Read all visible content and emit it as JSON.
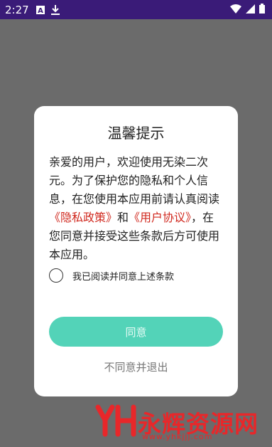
{
  "statusbar": {
    "time": "2:27",
    "icons": [
      "font-a-icon",
      "download-icon",
      "wifi-icon",
      "signal-icon",
      "battery-icon"
    ]
  },
  "dialog": {
    "title": "温馨提示",
    "text_prefix": "亲爱的用户，欢迎使用无染二次元。为了保护您的隐私和个人信息，在您使用本应用前请认真阅读",
    "privacy_link": "《隐私政策》",
    "conjunction": "和",
    "user_agreement_link": "《用户协议》",
    "text_suffix": "，在您同意并接受这些条款后方可使用本应用。",
    "checkbox_label": "我已阅读并同意上述条款",
    "agree_button": "同意",
    "disagree_button": "不同意并退出"
  },
  "watermark": {
    "text": "永辉资源网",
    "url": "www.yhkjjj.com"
  },
  "colors": {
    "status_bar": "#3a1b78",
    "overlay": "#6b6b6b",
    "accent": "#53d3b8",
    "link": "#d0281e",
    "watermark": "#e8272a"
  }
}
